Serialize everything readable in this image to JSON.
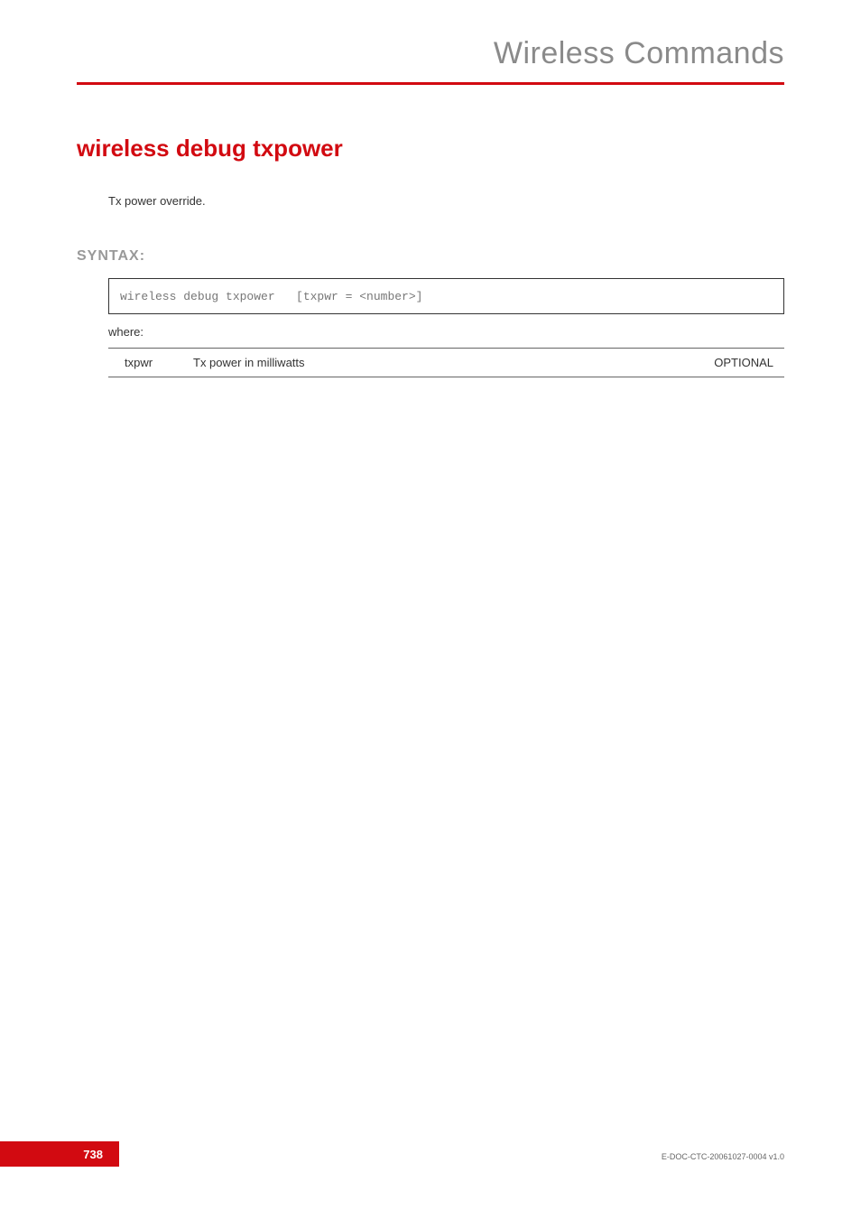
{
  "header": {
    "chapter_title": "Wireless Commands"
  },
  "main": {
    "command_title": "wireless debug txpower",
    "description": "Tx power override.",
    "syntax_label": "SYNTAX:",
    "syntax_code": "wireless debug txpower   [txpwr = <number>]",
    "where_label": "where:",
    "params": [
      {
        "name": "txpwr",
        "desc": "Tx power in milliwatts",
        "opt": "OPTIONAL"
      }
    ]
  },
  "footer": {
    "page_number": "738",
    "doc_id": "E-DOC-CTC-20061027-0004 v1.0"
  }
}
